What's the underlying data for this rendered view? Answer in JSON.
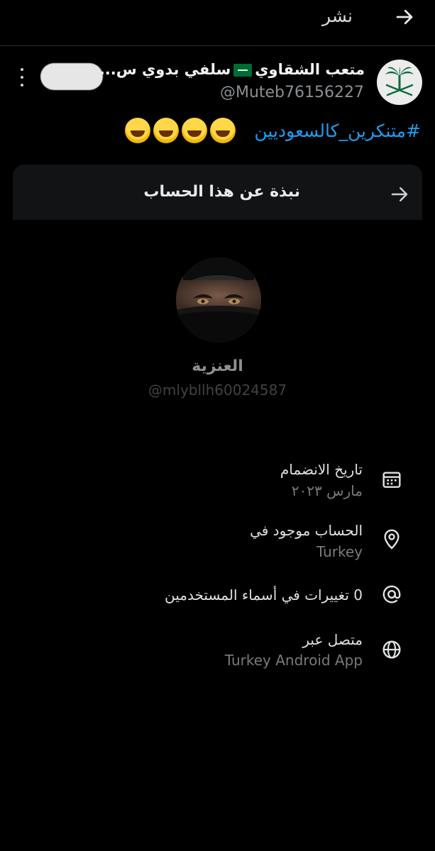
{
  "header": {
    "title": "نشر"
  },
  "tweet": {
    "author_name": "متعب الشقاوي",
    "author_name_rest": "سلفي بدوي س...",
    "author_handle": "@Muteb76156227",
    "text": "#متنكرين_كالسعوديين",
    "emoji_count": 4
  },
  "about_card": {
    "title": "نبذة عن هذا الحساب"
  },
  "profile": {
    "name": "العنزية",
    "handle": "@mlybllh60024587"
  },
  "info": {
    "joined_label": "تاريخ الانضمام",
    "joined_value": "مارس ٢٠٢٣",
    "location_label": "الحساب موجود في",
    "location_value": "Turkey",
    "username_changes": "0 تغييرات في أسماء المستخدمين",
    "connected_label": "متصل عبر",
    "connected_value": "Turkey Android App"
  },
  "icons": {
    "back": "arrow-right-icon",
    "more": "more-vertical-icon",
    "about": "arrow-right-icon",
    "joined": "calendar-icon",
    "location": "location-pin-icon",
    "username": "at-sign-icon",
    "connected": "globe-icon"
  },
  "colors": {
    "background": "#000000",
    "link": "#1d9bf0",
    "muted": "#777a7d",
    "card": "#121314"
  }
}
